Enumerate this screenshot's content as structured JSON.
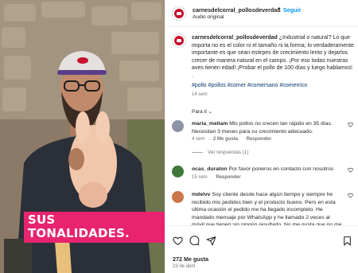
{
  "media": {
    "caption": "SUS TONALIDADES."
  },
  "header": {
    "username": "carnesdelcorral_pollosdeverdad",
    "separator": "•",
    "follow": "Seguir",
    "audio": "Audio original"
  },
  "post": {
    "username": "carnesdelcorral_pollosdeverdad",
    "text": "¿Industrial o natural? Lo que importa no es el color ni el tamaño ni la forma; lo verdaderamente importante es que sean estirpes de crecimiento lento y dejarlos crecer de manera natural en el campo. ¡Por eso todas nuestras aves tienen edad! ¡Probar el pollo de 100 días y luego hablamos!",
    "dot": ".",
    "hashtags": "#pollo #pollos #comer #comersano #comerrico",
    "time": "14 sem",
    "section": "Para ti",
    "section_chevron": "⌄"
  },
  "comments": [
    {
      "username": "maria_meliam",
      "text": "Mis pollos no crecen tan rápido en 35 días. Necesitan 3 meses para su crecimiento adecuado.",
      "time": "4 sem",
      "likes": "2 Me gusta",
      "reply": "Responder",
      "view_replies": "Ver respuestas (1)",
      "avatar_color": "#8b93a8"
    },
    {
      "username": "ocas_duraton",
      "text": "Por favor poneros en contacto con nosotros",
      "time": "15 sem",
      "reply": "Responder",
      "avatar_color": "#3f7a3a"
    },
    {
      "username": "mdelvv",
      "text": "Soy cliente desde hace algún tiempo y siempre he recibido mis pedidos bien y el producto bueno. Pero en esta última ocasión el pedido me ha llegado incompleto. He mandado mensaje por WhatsApp y he llamado 2 veces al móvil que tienen sin ningún resultado. No me gusta que no me estén atendiendo.",
      "avatar_color": "#c9764a"
    }
  ],
  "footer": {
    "likes": "272 Me gusta",
    "date": "23 de abril"
  },
  "icons": {
    "heart": "heart-icon",
    "comment": "comment-icon",
    "share": "share-icon",
    "save": "bookmark-icon"
  },
  "colors": {
    "accent": "#0095f6",
    "caption_bg": "#e8246e",
    "brand_red": "#c8102e"
  }
}
